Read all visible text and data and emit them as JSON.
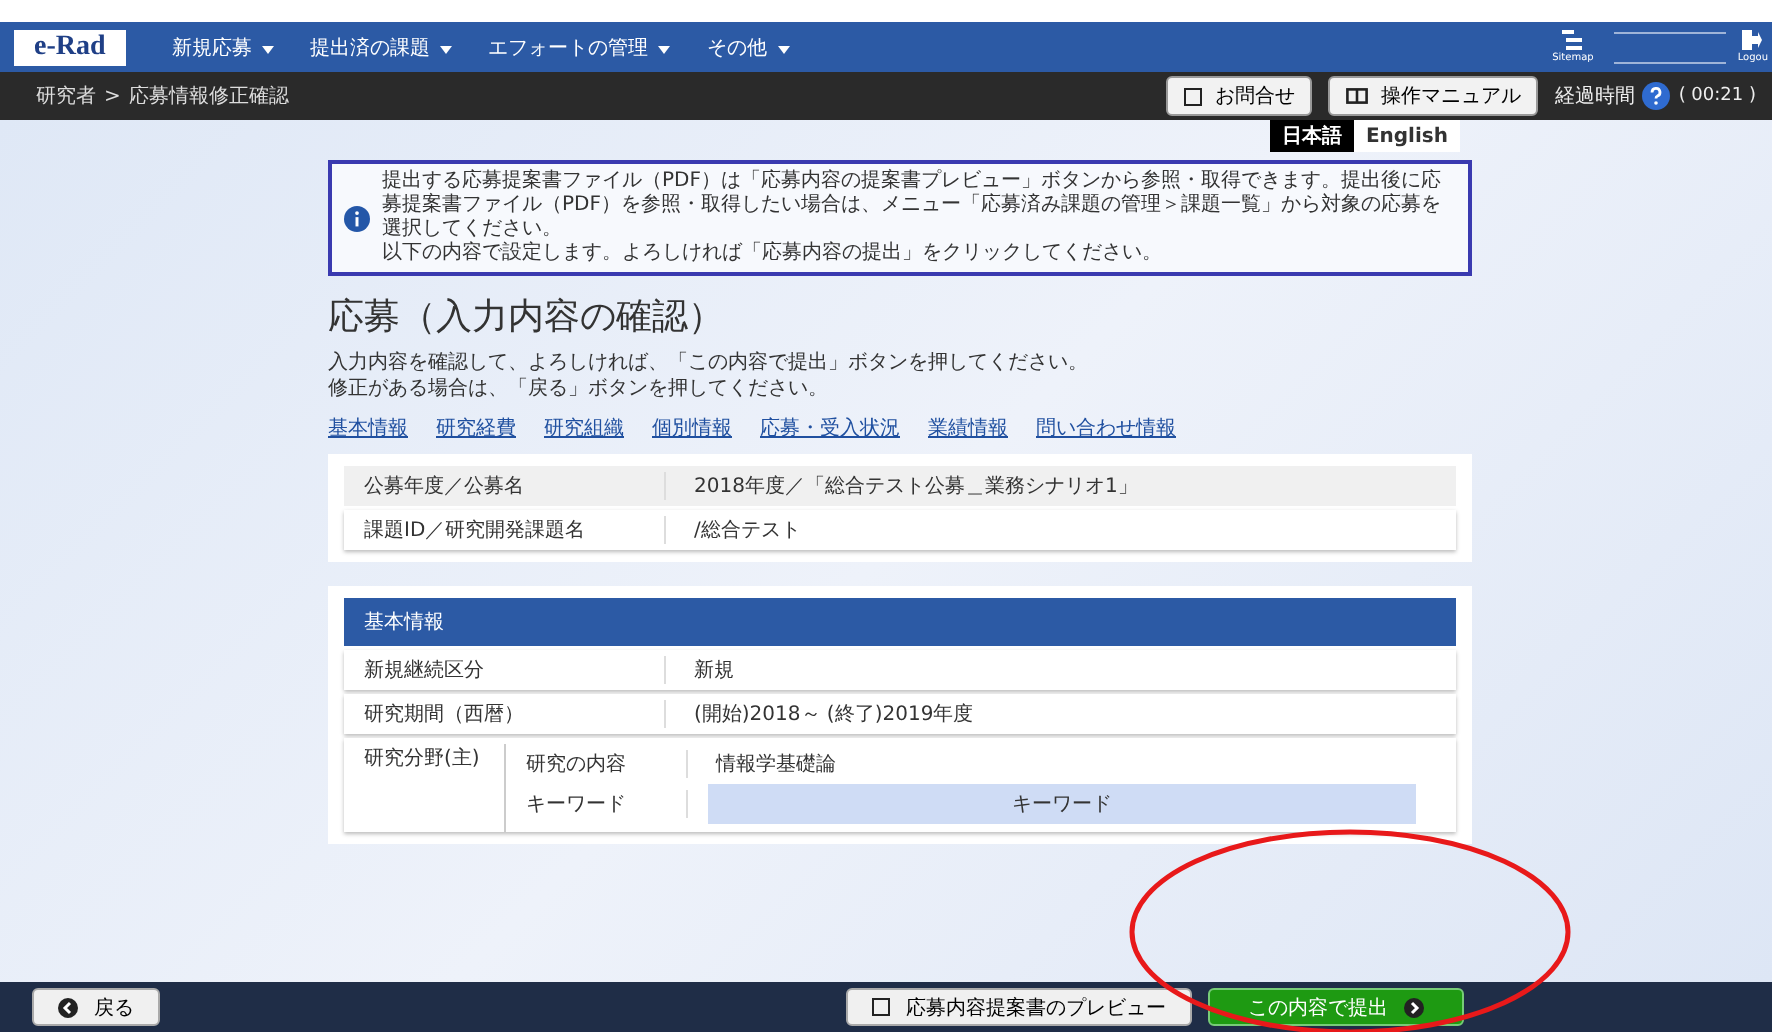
{
  "header": {
    "logo": "e-Rad",
    "menu": [
      {
        "label": "新規応募"
      },
      {
        "label": "提出済の課題"
      },
      {
        "label": "エフォートの管理"
      },
      {
        "label": "その他"
      }
    ],
    "sitemap": "Sitemap",
    "logout": "Logou"
  },
  "subbar": {
    "breadcrumb": [
      "研究者",
      "応募情報修正確認"
    ],
    "separator": ">",
    "contact": "お問合せ",
    "manual": "操作マニュアル",
    "elapsed_label": "経過時間",
    "elapsed": "( 00:21 )"
  },
  "languages": [
    {
      "label": "日本語",
      "selected": true
    },
    {
      "label": "English",
      "selected": false
    }
  ],
  "notice": [
    "提出する応募提案書ファイル（PDF）は「応募内容の提案書プレビュー」ボタンから参照・取得できます。提出後に応募提案書ファイル（PDF）を参照・取得したい場合は、メニュー「応募済み課題の管理＞課題一覧」から対象の応募を選択してください。",
    "以下の内容で設定します。よろしければ「応募内容の提出」をクリックしてください。"
  ],
  "title": "応募（入力内容の確認）",
  "description": [
    "入力内容を確認して、よろしければ、「この内容で提出」ボタンを押してください。",
    "修正がある場合は、「戻る」ボタンを押してください。"
  ],
  "section_links": [
    "基本情報",
    "研究経費",
    "研究組織",
    "個別情報",
    "応募・受入状況",
    "業績情報",
    "問い合わせ情報"
  ],
  "summary": [
    {
      "label": "公募年度／公募名",
      "value": "2018年度／「総合テスト公募＿業務シナリオ1」"
    },
    {
      "label": "課題ID／研究開発課題名",
      "value": "/総合テスト"
    }
  ],
  "basic_info": {
    "heading": "基本情報",
    "rows": [
      {
        "label": "新規継続区分",
        "value": "新規"
      },
      {
        "label": "研究期間（西暦）",
        "value": "(開始)2018～ (終了)2019年度"
      }
    ],
    "field": {
      "label": "研究分野(主)",
      "content_label": "研究の内容",
      "content_value": "情報学基礎論",
      "keyword_label": "キーワード",
      "keyword_header": "キーワード"
    }
  },
  "footer": {
    "back": "戻る",
    "preview": "応募内容提案書のプレビュー",
    "submit": "この内容で提出"
  }
}
